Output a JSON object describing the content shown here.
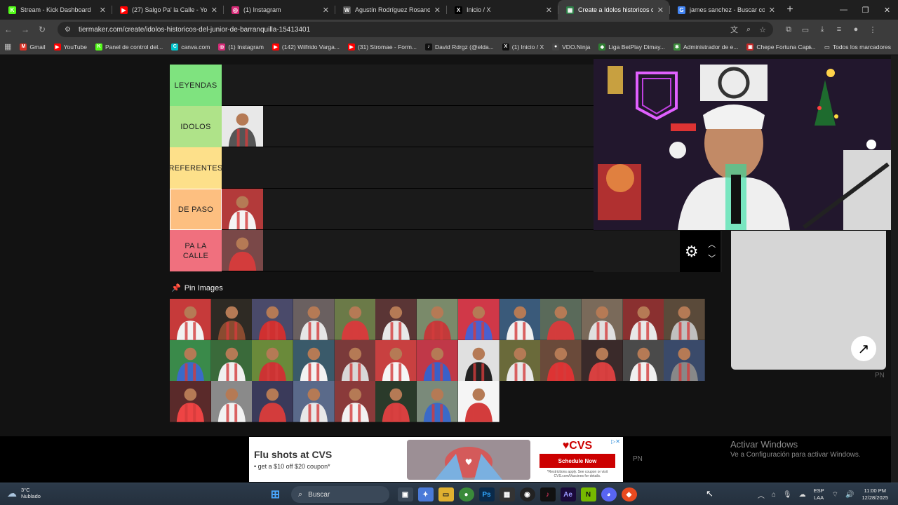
{
  "browser": {
    "tabs": [
      {
        "title": "Stream - Kick Dashboard",
        "fav": "K",
        "color": "#53fc18",
        "active": false
      },
      {
        "title": "(27) Salgo Pa' la Calle - YouTub",
        "fav": "▶",
        "color": "#ff0000",
        "active": false
      },
      {
        "title": "(1) Instagram",
        "fav": "◎",
        "color": "#d62976",
        "active": false
      },
      {
        "title": "Agustín Rodríguez Rosano - Wi",
        "fav": "W",
        "color": "#555555",
        "active": false
      },
      {
        "title": "Inicio / X",
        "fav": "X",
        "color": "#000000",
        "active": false
      },
      {
        "title": "Create a Idolos historicos del Ju",
        "fav": "▦",
        "color": "#2d7d46",
        "active": true
      },
      {
        "title": "james sanchez - Buscar con Go",
        "fav": "G",
        "color": "#4285f4",
        "active": false
      }
    ],
    "url": "tiermaker.com/create/idolos-historicos-del-junior-de-barranquilla-15413401",
    "bookmarks": [
      {
        "label": "Gmail",
        "fav": "M",
        "color": "#d93025"
      },
      {
        "label": "YouTube",
        "fav": "▶",
        "color": "#ff0000"
      },
      {
        "label": "Panel de control del...",
        "fav": "K",
        "color": "#53fc18"
      },
      {
        "label": "canva.com",
        "fav": "C",
        "color": "#00c4cc"
      },
      {
        "label": "(1) Instagram",
        "fav": "◎",
        "color": "#d62976"
      },
      {
        "label": "(142) Wilfrido Varga...",
        "fav": "▶",
        "color": "#ff0000"
      },
      {
        "label": "(31) Stromae - Form...",
        "fav": "▶",
        "color": "#ff0000"
      },
      {
        "label": "David Rdrgz (@elda...",
        "fav": "♪",
        "color": "#111111"
      },
      {
        "label": "(1) Inicio / X",
        "fav": "X",
        "color": "#111111"
      },
      {
        "label": "VDO.Ninja",
        "fav": "●",
        "color": "#444444"
      },
      {
        "label": "Liga BetPlay Dimay...",
        "fav": "◆",
        "color": "#2e7d32"
      },
      {
        "label": "Administrador de e...",
        "fav": "✱",
        "color": "#3c8d3c"
      },
      {
        "label": "Chepe Fortuna Capí...",
        "fav": "▣",
        "color": "#c62828"
      }
    ],
    "bookmarks_folder": "Todos los marcadores"
  },
  "tiers": [
    {
      "label": "LEYENDAS",
      "color": "#7fe37f",
      "items": []
    },
    {
      "label": "IDOLOS",
      "color": "#afe389",
      "items": [
        {
          "bg": "#e8e8e8",
          "fg": "#555555"
        }
      ]
    },
    {
      "label": "REFERENTES",
      "color": "#fde08a",
      "items": []
    },
    {
      "label": "DE PASO",
      "color": "#fdbf80",
      "items": [
        {
          "bg": "#b33a3a",
          "fg": "#f4f4f4"
        }
      ],
      "selected": true
    },
    {
      "label": "PA LA CALLE",
      "color": "#f0707e",
      "items": [
        {
          "bg": "#7a4848",
          "fg": "#d33c3c"
        }
      ]
    }
  ],
  "pin_section": {
    "title": "Pin Images"
  },
  "pool_colors": [
    [
      "#c63a3a",
      "#f2f2f2"
    ],
    [
      "#2e2a24",
      "#8a4b30"
    ],
    [
      "#4a4a6a",
      "#d03030"
    ],
    [
      "#6a6060",
      "#e6e6e6"
    ],
    [
      "#6b7a48",
      "#d53c3c"
    ],
    [
      "#5a3535",
      "#e8e8e8"
    ],
    [
      "#7a8a6a",
      "#c33a3a"
    ],
    [
      "#d03848",
      "#4a60d0"
    ],
    [
      "#3a5a7a",
      "#f0f0f0"
    ],
    [
      "#5a6a5a",
      "#d33c3c"
    ],
    [
      "#7a6a5a",
      "#e0e0e0"
    ],
    [
      "#8a3030",
      "#e8e8e8"
    ],
    [
      "#5a4a3a",
      "#c0c0c0"
    ],
    [
      "#3a8a4a",
      "#3a6ac8"
    ],
    [
      "#3a6a3a",
      "#f0f0f0"
    ],
    [
      "#6a8a3a",
      "#c33"
    ],
    [
      "#3a5a6a",
      "#f2f2f2"
    ],
    [
      "#7a3a3a",
      "#d8d8d8"
    ],
    [
      "#c84040",
      "#f5f5f5"
    ],
    [
      "#c03848",
      "#3a60c8"
    ],
    [
      "#e0e0e0",
      "#222222"
    ],
    [
      "#6a6a3a",
      "#e8e8e8"
    ],
    [
      "#6a4a3a",
      "#d33"
    ],
    [
      "#3a2a2a",
      "#d84040"
    ],
    [
      "#4a4a4a",
      "#f0f0f0"
    ],
    [
      "#3a4a6a",
      "#888888"
    ],
    [
      "#5a2a2a",
      "#e44"
    ],
    [
      "#8a8a8a",
      "#f2f2f2"
    ],
    [
      "#3a3a5a",
      "#d33c3c"
    ],
    [
      "#5a6a8a",
      "#e8e8e8"
    ],
    [
      "#8a3a3a",
      "#f2f2f2"
    ],
    [
      "#2a3a2a",
      "#d84040"
    ],
    [
      "#7a8a7a",
      "#3a6ac8"
    ],
    [
      "#f5f5f5",
      "#d33c3c"
    ]
  ],
  "panel": {
    "pn": "PN"
  },
  "ad": {
    "headline": "Flu shots at CVS",
    "sub": "• get a $10 off $20 coupon*",
    "logo": "♥CVS",
    "button": "Schedule Now",
    "fine": "*Restrictions apply. See coupon or visit CVS.com/Vaccines for details."
  },
  "pn_ad": "PN",
  "activation": {
    "title": "Activar Windows",
    "sub": "Ve a Configuración para activar Windows."
  },
  "taskbar": {
    "weather_temp": "3°C",
    "weather_desc": "Nublado",
    "search_placeholder": "Buscar",
    "lang1": "ESP",
    "lang2": "LAA",
    "time": "11:00 PM",
    "date": "12/28/2025"
  }
}
